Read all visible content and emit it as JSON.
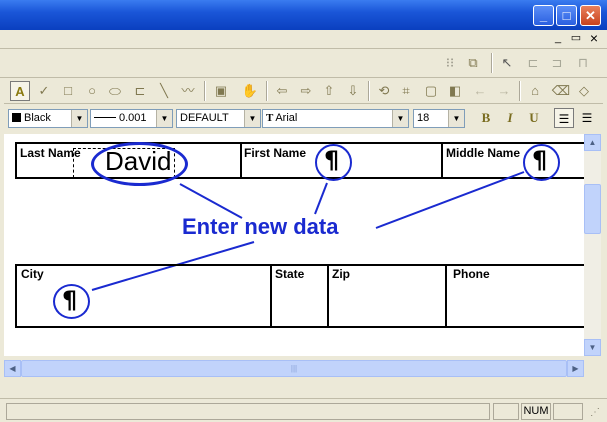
{
  "window": {
    "minimize_glyph": "_",
    "maximize_glyph": "□",
    "close_glyph": "✕"
  },
  "mdi": {
    "minimize_glyph": "_",
    "restore_glyph": "▭",
    "close_glyph": "×"
  },
  "toolbar_format": {
    "color": "Black",
    "line_width": "0.001",
    "style": "DEFAULT",
    "font": "Arial",
    "font_icon": "T",
    "size": "18",
    "bold": "B",
    "italic": "I",
    "underline": "U"
  },
  "form": {
    "row1": [
      {
        "label": "Last Name",
        "value": "David"
      },
      {
        "label": "First Name",
        "value": "¶"
      },
      {
        "label": "Middle Name",
        "value": "¶"
      }
    ],
    "row2": [
      {
        "label": "City",
        "value": "¶"
      },
      {
        "label": "State",
        "value": ""
      },
      {
        "label": "Zip",
        "value": ""
      },
      {
        "label": "Phone",
        "value": ""
      }
    ]
  },
  "annotation": {
    "text": "Enter new data",
    "color": "#1a2ad0"
  },
  "statusbar": {
    "num": "NUM"
  }
}
